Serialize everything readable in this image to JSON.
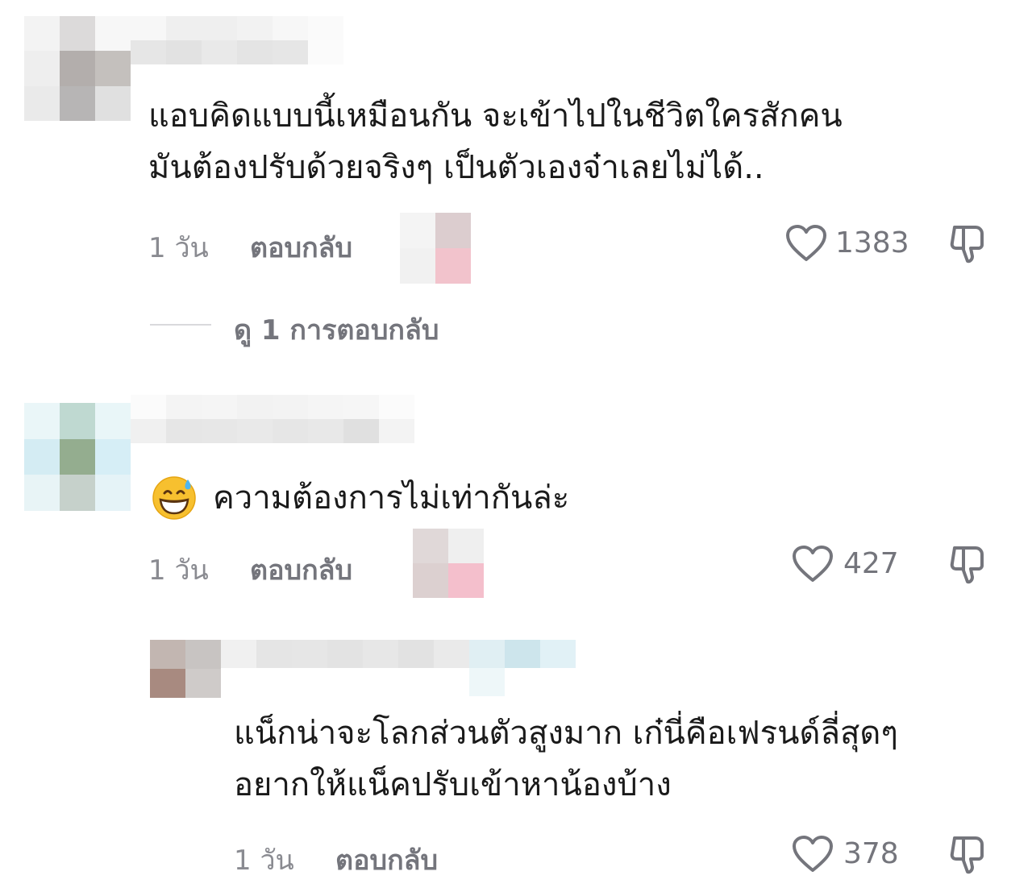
{
  "comments": [
    {
      "text_lines": [
        "แอบคิดแบบนี้เหมือนกัน จะเข้าไปในชีวิตใครสักคน",
        "มันต้องปรับด้วยจริงๆ เป็นตัวเองจ๋าเลยไม่ได้.."
      ],
      "time": "1 วัน",
      "reply_label": "ตอบกลับ",
      "likes": "1383",
      "view_replies": "ดู 1 การตอบกลับ"
    },
    {
      "emoji": "grinning-face-with-sweat",
      "text_lines": [
        "ความต้องการไม่เท่ากันล่ะ"
      ],
      "time": "1 วัน",
      "reply_label": "ตอบกลับ",
      "likes": "427"
    },
    {
      "text_lines": [
        "แน็กน่าจะโลกส่วนตัวสูงมาก เก๋นี่คือเฟรนด์ลี่สุดๆ",
        "อยากให้แน็คปรับเข้าหาน้องบ้าง"
      ],
      "time": "1 วัน",
      "reply_label": "ตอบกลับ",
      "likes": "378"
    }
  ],
  "colors": {
    "text": "#1a1a1a",
    "secondary": "#8a8b91",
    "icon": "#74757c"
  },
  "icons": {
    "like": "heart-outline-icon",
    "dislike": "thumbs-down-icon"
  }
}
